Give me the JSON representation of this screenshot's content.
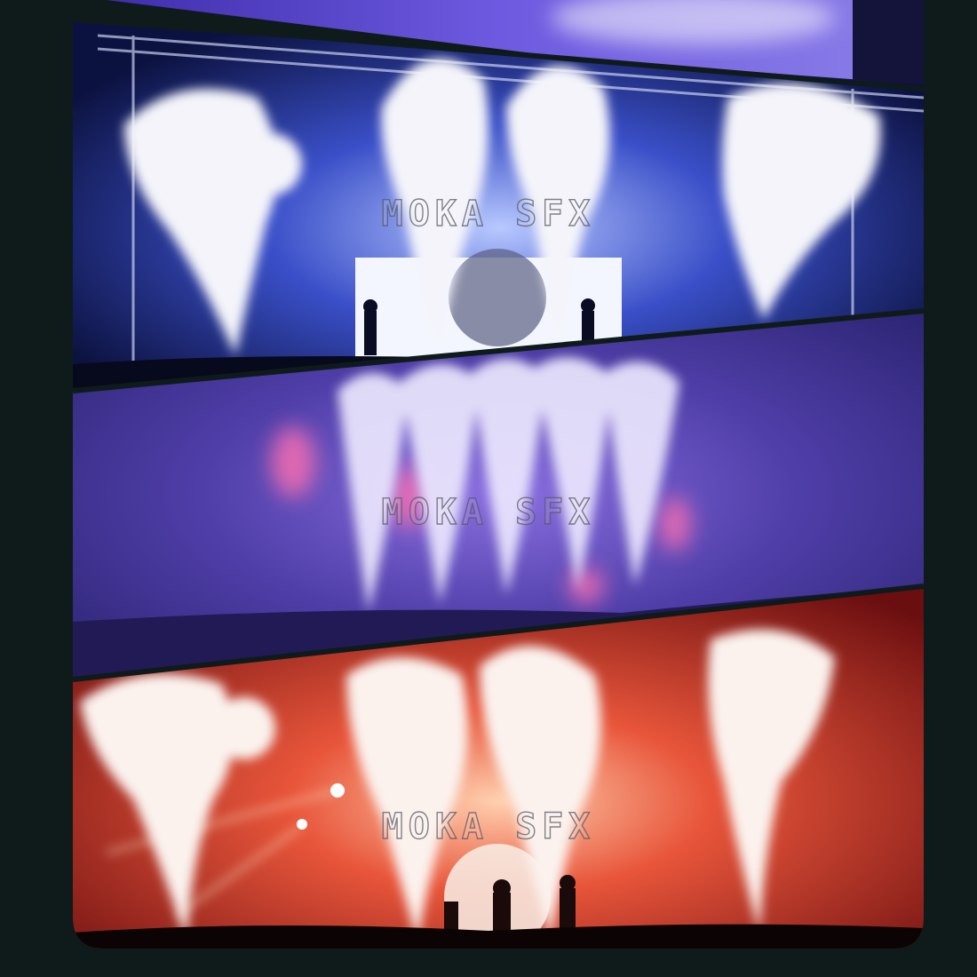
{
  "panels": [
    {
      "name": "top-strip",
      "tone": "violet"
    },
    {
      "name": "blue-stage",
      "tone": "blue",
      "watermark": "MOKA SFX"
    },
    {
      "name": "purple-stage",
      "tone": "purple",
      "watermark": "MOKA SFX"
    },
    {
      "name": "red-stage",
      "tone": "red",
      "watermark": "MOKA SFX"
    }
  ],
  "colors": {
    "background": "#0f1b1a",
    "blue_stage": "#1b2a8a",
    "purple_stage": "#4a3a9a",
    "red_stage": "#c8301e",
    "smoke": "#f4f4fa"
  }
}
